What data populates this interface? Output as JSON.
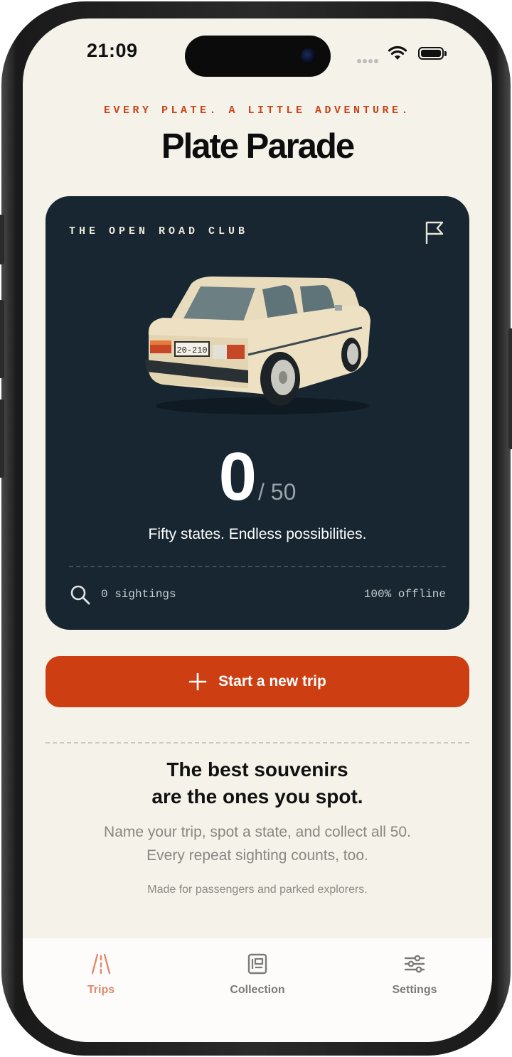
{
  "status_bar": {
    "time": "21:09"
  },
  "header": {
    "tagline": "EVERY PLATE. A LITTLE ADVENTURE.",
    "title": "Plate Parade"
  },
  "hero_card": {
    "club_label": "THE OPEN ROAD CLUB",
    "car_plate": "20-210",
    "count": "0",
    "total": "/ 50",
    "motto": "Fifty states. Endless possibilities.",
    "sightings": "0 sightings",
    "offline": "100% offline",
    "icons": [
      "flag-icon",
      "search-icon"
    ]
  },
  "cta": {
    "label": "Start a new trip",
    "icon": "plus-icon"
  },
  "info": {
    "heading_line1": "The best souvenirs",
    "heading_line2": "are the ones you spot.",
    "body_line1": "Name your trip, spot a state, and collect all 50.",
    "body_line2": "Every repeat sighting counts, too.",
    "footnote": "Made for passengers and parked explorers."
  },
  "tabs": [
    {
      "label": "Trips",
      "icon": "road-icon",
      "active": true
    },
    {
      "label": "Collection",
      "icon": "collection-icon",
      "active": false
    },
    {
      "label": "Settings",
      "icon": "sliders-icon",
      "active": false
    }
  ],
  "colors": {
    "accent": "#cd3f12",
    "card": "#172631",
    "background": "#f5f2ea",
    "active_tab": "#df8a6c"
  }
}
